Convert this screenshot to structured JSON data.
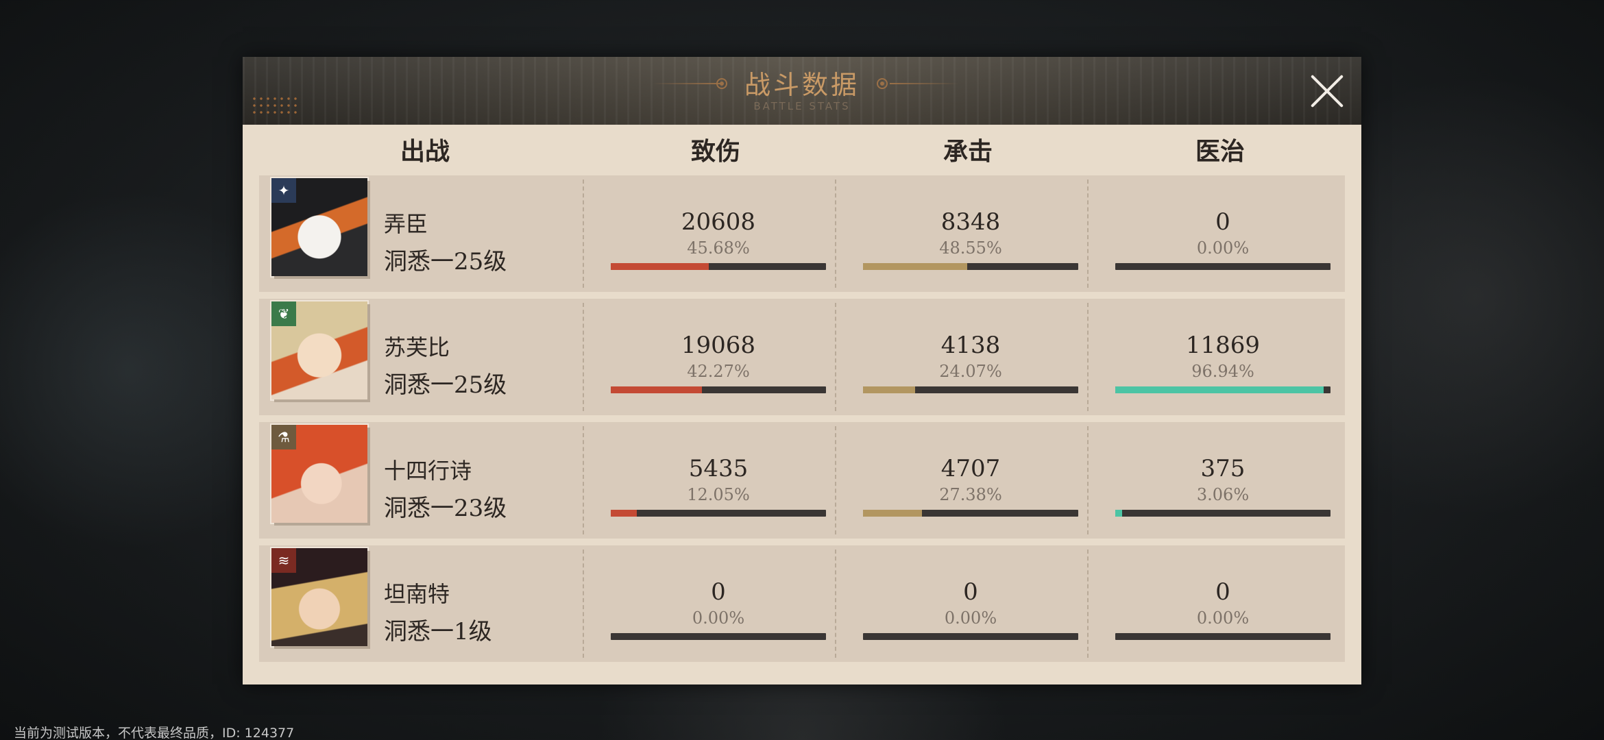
{
  "header": {
    "title": "战斗数据",
    "subtitle": "BATTLE STATS"
  },
  "columns": {
    "deploy": "出战",
    "damage": "致伤",
    "tanking": "承击",
    "healing": "医治"
  },
  "colors": {
    "damage_bar": "#c44a34",
    "tanking_bar": "#b29660",
    "healing_bar": "#4cc4a4",
    "bar_track": "#3a3634",
    "panel_bg": "#e8dccb"
  },
  "rows": [
    {
      "name": "弄臣",
      "level": "洞悉一25级",
      "badge_icon": "sparkle-icon",
      "badge_color": "#2b3b58",
      "damage": {
        "value": "20608",
        "percent": "45.68%",
        "ratio": 0.4568
      },
      "tanking": {
        "value": "8348",
        "percent": "48.55%",
        "ratio": 0.4855
      },
      "healing": {
        "value": "0",
        "percent": "0.00%",
        "ratio": 0
      }
    },
    {
      "name": "苏芙比",
      "level": "洞悉一25级",
      "badge_icon": "leaf-icon",
      "badge_color": "#3b7a4a",
      "damage": {
        "value": "19068",
        "percent": "42.27%",
        "ratio": 0.4227
      },
      "tanking": {
        "value": "4138",
        "percent": "24.07%",
        "ratio": 0.2407
      },
      "healing": {
        "value": "11869",
        "percent": "96.94%",
        "ratio": 0.9694
      }
    },
    {
      "name": "十四行诗",
      "level": "洞悉一23级",
      "badge_icon": "flask-icon",
      "badge_color": "#6e5a3e",
      "damage": {
        "value": "5435",
        "percent": "12.05%",
        "ratio": 0.1205
      },
      "tanking": {
        "value": "4707",
        "percent": "27.38%",
        "ratio": 0.2738
      },
      "healing": {
        "value": "375",
        "percent": "3.06%",
        "ratio": 0.0306
      }
    },
    {
      "name": "坦南特",
      "level": "洞悉一1级",
      "badge_icon": "claw-icon",
      "badge_color": "#7a2a22",
      "damage": {
        "value": "0",
        "percent": "0.00%",
        "ratio": 0
      },
      "tanking": {
        "value": "0",
        "percent": "0.00%",
        "ratio": 0
      },
      "healing": {
        "value": "0",
        "percent": "0.00%",
        "ratio": 0
      }
    }
  ],
  "footer_note": "当前为测试版本，不代表最终品质，ID: 124377"
}
